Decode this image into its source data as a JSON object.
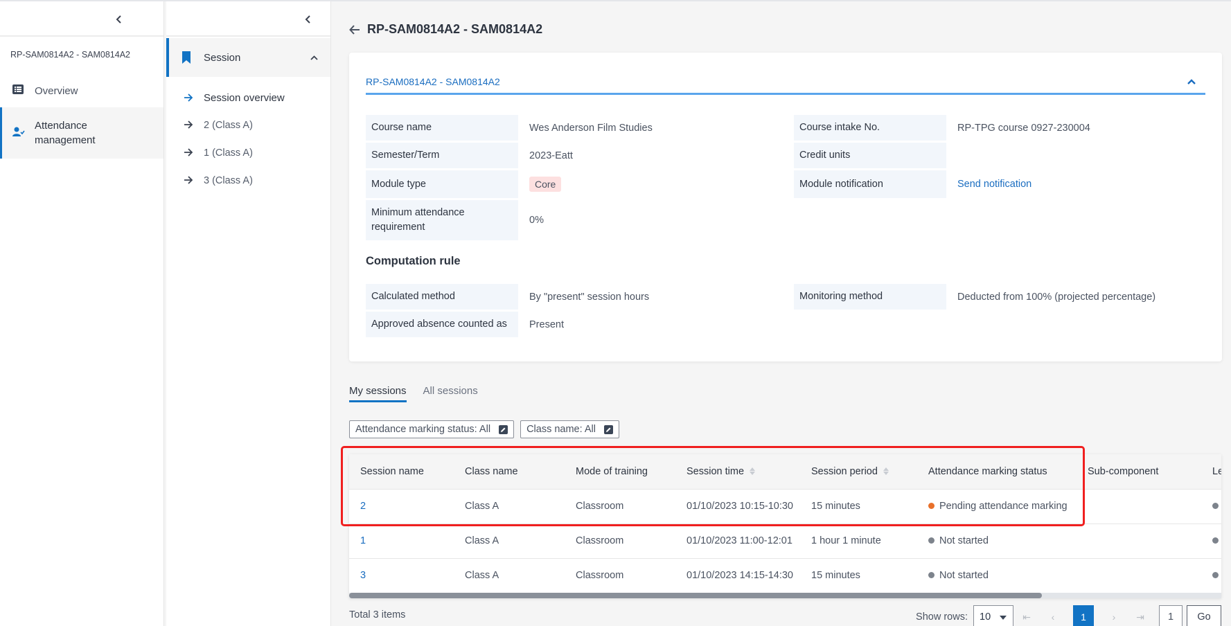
{
  "sidebar_primary": {
    "course_code": "RP-SAM0814A2 - SAM0814A2",
    "items": [
      {
        "label": "Overview",
        "icon": "list-icon",
        "active": false
      },
      {
        "label": "Attendance management",
        "icon": "user-check-icon",
        "active": true
      }
    ]
  },
  "sidebar_secondary": {
    "group": {
      "label": "Session",
      "icon": "bookmark-icon",
      "expanded": true
    },
    "items": [
      {
        "label": "Session overview",
        "active": true
      },
      {
        "label": "2 (Class A)"
      },
      {
        "label": "1 (Class A)"
      },
      {
        "label": "3 (Class A)"
      }
    ]
  },
  "header": {
    "title": "RP-SAM0814A2 - SAM0814A2"
  },
  "details": {
    "panel_title": "RP-SAM0814A2 - SAM0814A2",
    "fields_left": [
      {
        "label": "Course name",
        "value": "Wes Anderson Film Studies"
      },
      {
        "label": "Semester/Term",
        "value": "2023-Eatt"
      },
      {
        "label": "Module type",
        "value": "Core"
      },
      {
        "label": "Minimum attendance requirement",
        "value": "0%"
      }
    ],
    "fields_right": [
      {
        "label": "Course intake No.",
        "value": "RP-TPG course 0927-230004"
      },
      {
        "label": "Credit units",
        "value": ""
      },
      {
        "label": "Module notification",
        "value": "Send notification"
      }
    ],
    "computation_title": "Computation rule",
    "computation_left": [
      {
        "label": "Calculated method",
        "value": "By \"present\" session hours"
      },
      {
        "label": "Approved absence counted as",
        "value": "Present"
      }
    ],
    "computation_right": [
      {
        "label": "Monitoring method",
        "value": "Deducted from 100% (projected percentage)"
      }
    ]
  },
  "tabs": [
    {
      "label": "My sessions",
      "active": true
    },
    {
      "label": "All sessions",
      "active": false
    }
  ],
  "filters": [
    {
      "label": "Attendance marking status: All"
    },
    {
      "label": "Class name: All"
    }
  ],
  "table": {
    "columns": [
      "Session name",
      "Class name",
      "Mode of training",
      "Session time",
      "Session period",
      "Attendance marking status",
      "Sub-component",
      "Le"
    ],
    "rows": [
      {
        "session_name": "2",
        "class_name": "Class A",
        "mode": "Classroom",
        "time": "01/10/2023 10:15-10:30",
        "period": "15 minutes",
        "status": "Pending attendance marking",
        "status_color": "#e8702a",
        "sub_component": ""
      },
      {
        "session_name": "1",
        "class_name": "Class A",
        "mode": "Classroom",
        "time": "01/10/2023 11:00-12:01",
        "period": "1 hour 1 minute",
        "status": "Not started",
        "status_color": "#7d838c",
        "sub_component": ""
      },
      {
        "session_name": "3",
        "class_name": "Class A",
        "mode": "Classroom",
        "time": "01/10/2023 14:15-14:30",
        "period": "15 minutes",
        "status": "Not started",
        "status_color": "#7d838c",
        "sub_component": ""
      }
    ]
  },
  "footer": {
    "total": "Total 3 items",
    "show_rows_label": "Show rows:",
    "rows_per_page": "10",
    "current_page": "1",
    "page_input": "1",
    "go_label": "Go"
  },
  "colors": {
    "accent": "#1273c4",
    "link": "#1a6dc0",
    "highlight_box": "#f01f1f"
  }
}
